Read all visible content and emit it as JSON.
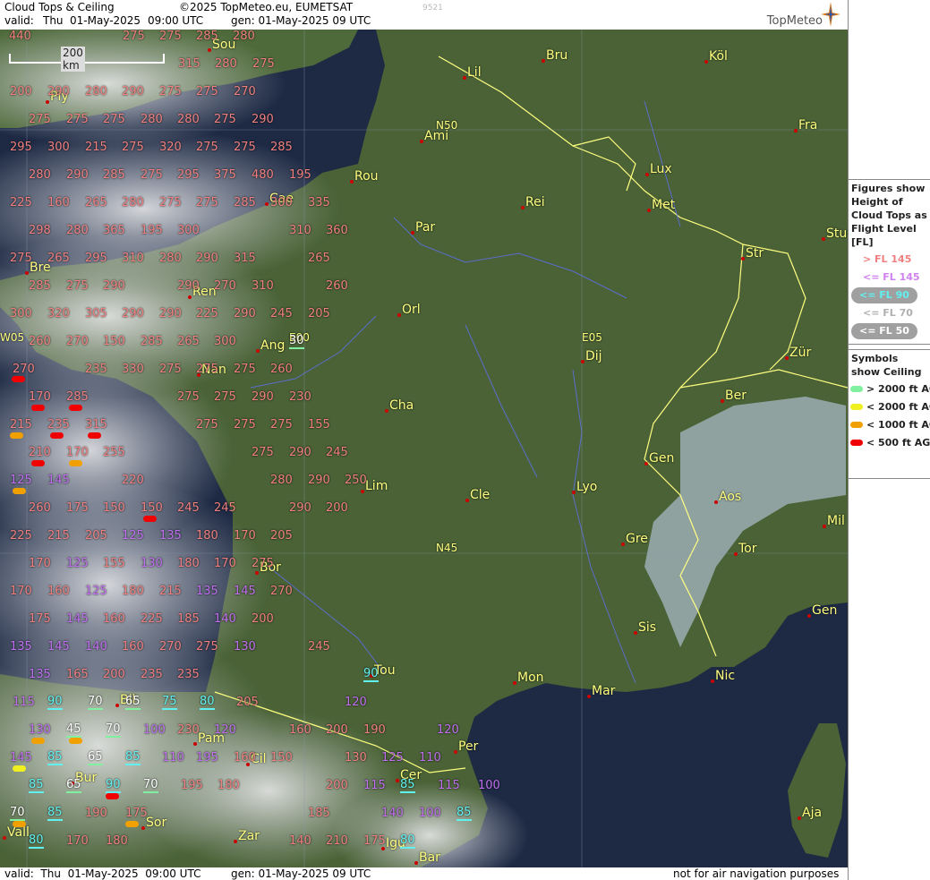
{
  "header": {
    "title": "Cloud Tops & Ceiling",
    "copyright": "©2025 TopMeteo.eu, EUMETSAT",
    "valid_label": "valid:",
    "valid_day": "Thu",
    "valid_date": "01-May-2025",
    "valid_time": "09:00 UTC",
    "gen": "gen: 01-May-2025 09 UTC",
    "code": "9521",
    "brand": "TopMeteo"
  },
  "footer": {
    "valid": "valid:  Thu  01-May-2025  09:00 UTC",
    "gen": "gen: 01-May-2025 09 UTC",
    "disclaimer": "not for air navigation purposes"
  },
  "scale": {
    "label": "200 km"
  },
  "grid_labels": [
    "N50",
    "E00",
    "E05",
    "N45",
    "W05"
  ],
  "cities": [
    {
      "name": "Sou"
    },
    {
      "name": "Bru"
    },
    {
      "name": "Köl"
    },
    {
      "name": "Lil"
    },
    {
      "name": "Ply"
    },
    {
      "name": "Ami"
    },
    {
      "name": "Fra"
    },
    {
      "name": "Lux"
    },
    {
      "name": "Rou"
    },
    {
      "name": "Cae"
    },
    {
      "name": "Rei"
    },
    {
      "name": "Met"
    },
    {
      "name": "Par"
    },
    {
      "name": "Stu"
    },
    {
      "name": "Str"
    },
    {
      "name": "Bre"
    },
    {
      "name": "Ren"
    },
    {
      "name": "Orl"
    },
    {
      "name": "Ang"
    },
    {
      "name": "Nan"
    },
    {
      "name": "Dij"
    },
    {
      "name": "Zür"
    },
    {
      "name": "Ber"
    },
    {
      "name": "Cha"
    },
    {
      "name": "Gen"
    },
    {
      "name": "Lim"
    },
    {
      "name": "Cle"
    },
    {
      "name": "Lyo"
    },
    {
      "name": "Aos"
    },
    {
      "name": "Mil"
    },
    {
      "name": "Gre"
    },
    {
      "name": "Tor"
    },
    {
      "name": "Bor"
    },
    {
      "name": "Sis"
    },
    {
      "name": "Gen"
    },
    {
      "name": "Tou"
    },
    {
      "name": "Mon"
    },
    {
      "name": "Mar"
    },
    {
      "name": "Nic"
    },
    {
      "name": "Bil"
    },
    {
      "name": "Pam"
    },
    {
      "name": "Cil"
    },
    {
      "name": "Per"
    },
    {
      "name": "Cer"
    },
    {
      "name": "Bur"
    },
    {
      "name": "Sor"
    },
    {
      "name": "Vall"
    },
    {
      "name": "Zar"
    },
    {
      "name": "Igu"
    },
    {
      "name": "Bar"
    },
    {
      "name": "Aja"
    }
  ],
  "fl_values": [
    {
      "v": "440",
      "c": "salmon"
    },
    {
      "v": "275",
      "c": "salmon"
    },
    {
      "v": "275",
      "c": "salmon"
    },
    {
      "v": "285",
      "c": "salmon"
    },
    {
      "v": "280",
      "c": "salmon"
    },
    {
      "v": "315",
      "c": "salmon"
    },
    {
      "v": "280",
      "c": "salmon"
    },
    {
      "v": "275",
      "c": "salmon"
    },
    {
      "v": "200",
      "c": "salmon"
    },
    {
      "v": "290",
      "c": "salmon"
    },
    {
      "v": "280",
      "c": "salmon"
    },
    {
      "v": "290",
      "c": "salmon"
    },
    {
      "v": "275",
      "c": "salmon"
    },
    {
      "v": "275",
      "c": "salmon"
    },
    {
      "v": "270",
      "c": "salmon"
    },
    {
      "v": "275",
      "c": "salmon"
    },
    {
      "v": "275",
      "c": "salmon"
    },
    {
      "v": "275",
      "c": "salmon"
    },
    {
      "v": "280",
      "c": "salmon"
    },
    {
      "v": "280",
      "c": "salmon"
    },
    {
      "v": "275",
      "c": "salmon"
    },
    {
      "v": "290",
      "c": "salmon"
    },
    {
      "v": "295",
      "c": "salmon"
    },
    {
      "v": "300",
      "c": "salmon"
    },
    {
      "v": "215",
      "c": "salmon"
    },
    {
      "v": "275",
      "c": "salmon"
    },
    {
      "v": "320",
      "c": "salmon"
    },
    {
      "v": "275",
      "c": "salmon"
    },
    {
      "v": "275",
      "c": "salmon"
    },
    {
      "v": "285",
      "c": "salmon"
    },
    {
      "v": "280",
      "c": "salmon"
    },
    {
      "v": "290",
      "c": "salmon"
    },
    {
      "v": "285",
      "c": "salmon"
    },
    {
      "v": "275",
      "c": "salmon"
    },
    {
      "v": "295",
      "c": "salmon"
    },
    {
      "v": "375",
      "c": "salmon"
    },
    {
      "v": "480",
      "c": "salmon"
    },
    {
      "v": "195",
      "c": "salmon"
    },
    {
      "v": "225",
      "c": "salmon"
    },
    {
      "v": "160",
      "c": "salmon"
    },
    {
      "v": "265",
      "c": "salmon"
    },
    {
      "v": "280",
      "c": "salmon"
    },
    {
      "v": "275",
      "c": "salmon"
    },
    {
      "v": "275",
      "c": "salmon"
    },
    {
      "v": "285",
      "c": "salmon"
    },
    {
      "v": "300",
      "c": "salmon"
    },
    {
      "v": "335",
      "c": "salmon"
    },
    {
      "v": "298",
      "c": "salmon"
    },
    {
      "v": "280",
      "c": "salmon"
    },
    {
      "v": "365",
      "c": "salmon"
    },
    {
      "v": "195",
      "c": "salmon"
    },
    {
      "v": "300",
      "c": "salmon"
    },
    {
      "v": "310",
      "c": "salmon"
    },
    {
      "v": "360",
      "c": "salmon"
    },
    {
      "v": "275",
      "c": "salmon"
    },
    {
      "v": "265",
      "c": "salmon"
    },
    {
      "v": "295",
      "c": "salmon"
    },
    {
      "v": "310",
      "c": "salmon"
    },
    {
      "v": "280",
      "c": "salmon"
    },
    {
      "v": "290",
      "c": "salmon"
    },
    {
      "v": "315",
      "c": "salmon"
    },
    {
      "v": "265",
      "c": "salmon"
    },
    {
      "v": "285",
      "c": "salmon"
    },
    {
      "v": "275",
      "c": "salmon"
    },
    {
      "v": "290",
      "c": "salmon"
    },
    {
      "v": "290",
      "c": "salmon"
    },
    {
      "v": "270",
      "c": "salmon"
    },
    {
      "v": "310",
      "c": "salmon"
    },
    {
      "v": "260",
      "c": "salmon"
    },
    {
      "v": "300",
      "c": "salmon"
    },
    {
      "v": "320",
      "c": "salmon"
    },
    {
      "v": "305",
      "c": "salmon"
    },
    {
      "v": "290",
      "c": "salmon"
    },
    {
      "v": "290",
      "c": "salmon"
    },
    {
      "v": "225",
      "c": "salmon"
    },
    {
      "v": "290",
      "c": "salmon"
    },
    {
      "v": "245",
      "c": "salmon"
    },
    {
      "v": "205",
      "c": "salmon"
    },
    {
      "v": "260",
      "c": "salmon"
    },
    {
      "v": "270",
      "c": "salmon"
    },
    {
      "v": "150",
      "c": "salmon"
    },
    {
      "v": "285",
      "c": "salmon"
    },
    {
      "v": "265",
      "c": "salmon"
    },
    {
      "v": "300",
      "c": "salmon"
    },
    {
      "v": "30",
      "c": "white"
    },
    {
      "v": "270",
      "c": "salmon"
    },
    {
      "v": "235",
      "c": "salmon"
    },
    {
      "v": "330",
      "c": "salmon"
    },
    {
      "v": "275",
      "c": "salmon"
    },
    {
      "v": "275",
      "c": "salmon"
    },
    {
      "v": "275",
      "c": "salmon"
    },
    {
      "v": "260",
      "c": "salmon"
    },
    {
      "v": "170",
      "c": "salmon"
    },
    {
      "v": "285",
      "c": "salmon"
    },
    {
      "v": "275",
      "c": "salmon"
    },
    {
      "v": "275",
      "c": "salmon"
    },
    {
      "v": "290",
      "c": "salmon"
    },
    {
      "v": "230",
      "c": "salmon"
    },
    {
      "v": "215",
      "c": "salmon"
    },
    {
      "v": "235",
      "c": "salmon"
    },
    {
      "v": "315",
      "c": "salmon"
    },
    {
      "v": "275",
      "c": "salmon"
    },
    {
      "v": "275",
      "c": "salmon"
    },
    {
      "v": "275",
      "c": "salmon"
    },
    {
      "v": "155",
      "c": "salmon"
    },
    {
      "v": "210",
      "c": "salmon"
    },
    {
      "v": "170",
      "c": "salmon"
    },
    {
      "v": "255",
      "c": "salmon"
    },
    {
      "v": "275",
      "c": "salmon"
    },
    {
      "v": "290",
      "c": "salmon"
    },
    {
      "v": "245",
      "c": "salmon"
    },
    {
      "v": "125",
      "c": "violet"
    },
    {
      "v": "145",
      "c": "violet"
    },
    {
      "v": "220",
      "c": "salmon"
    },
    {
      "v": "280",
      "c": "salmon"
    },
    {
      "v": "290",
      "c": "salmon"
    },
    {
      "v": "250",
      "c": "salmon"
    },
    {
      "v": "260",
      "c": "salmon"
    },
    {
      "v": "175",
      "c": "salmon"
    },
    {
      "v": "150",
      "c": "salmon"
    },
    {
      "v": "150",
      "c": "salmon"
    },
    {
      "v": "245",
      "c": "salmon"
    },
    {
      "v": "245",
      "c": "salmon"
    },
    {
      "v": "290",
      "c": "salmon"
    },
    {
      "v": "200",
      "c": "salmon"
    },
    {
      "v": "225",
      "c": "salmon"
    },
    {
      "v": "215",
      "c": "salmon"
    },
    {
      "v": "205",
      "c": "salmon"
    },
    {
      "v": "125",
      "c": "violet"
    },
    {
      "v": "135",
      "c": "violet"
    },
    {
      "v": "180",
      "c": "salmon"
    },
    {
      "v": "170",
      "c": "salmon"
    },
    {
      "v": "205",
      "c": "salmon"
    },
    {
      "v": "170",
      "c": "salmon"
    },
    {
      "v": "125",
      "c": "violet"
    },
    {
      "v": "155",
      "c": "salmon"
    },
    {
      "v": "130",
      "c": "violet"
    },
    {
      "v": "180",
      "c": "salmon"
    },
    {
      "v": "170",
      "c": "salmon"
    },
    {
      "v": "275",
      "c": "salmon"
    },
    {
      "v": "170",
      "c": "salmon"
    },
    {
      "v": "160",
      "c": "salmon"
    },
    {
      "v": "125",
      "c": "violet"
    },
    {
      "v": "180",
      "c": "salmon"
    },
    {
      "v": "215",
      "c": "salmon"
    },
    {
      "v": "135",
      "c": "violet"
    },
    {
      "v": "145",
      "c": "violet"
    },
    {
      "v": "270",
      "c": "salmon"
    },
    {
      "v": "175",
      "c": "salmon"
    },
    {
      "v": "145",
      "c": "violet"
    },
    {
      "v": "160",
      "c": "salmon"
    },
    {
      "v": "225",
      "c": "salmon"
    },
    {
      "v": "185",
      "c": "salmon"
    },
    {
      "v": "140",
      "c": "violet"
    },
    {
      "v": "200",
      "c": "salmon"
    },
    {
      "v": "135",
      "c": "violet"
    },
    {
      "v": "145",
      "c": "violet"
    },
    {
      "v": "140",
      "c": "violet"
    },
    {
      "v": "160",
      "c": "salmon"
    },
    {
      "v": "270",
      "c": "salmon"
    },
    {
      "v": "275",
      "c": "salmon"
    },
    {
      "v": "130",
      "c": "violet"
    },
    {
      "v": "245",
      "c": "salmon"
    },
    {
      "v": "135",
      "c": "violet"
    },
    {
      "v": "165",
      "c": "salmon"
    },
    {
      "v": "200",
      "c": "salmon"
    },
    {
      "v": "235",
      "c": "salmon"
    },
    {
      "v": "235",
      "c": "salmon"
    },
    {
      "v": "90",
      "c": "cyan"
    },
    {
      "v": "115",
      "c": "violet"
    },
    {
      "v": "90",
      "c": "cyan"
    },
    {
      "v": "70",
      "c": "white"
    },
    {
      "v": "65",
      "c": "white"
    },
    {
      "v": "75",
      "c": "cyan"
    },
    {
      "v": "80",
      "c": "cyan"
    },
    {
      "v": "205",
      "c": "salmon"
    },
    {
      "v": "120",
      "c": "violet"
    },
    {
      "v": "130",
      "c": "violet"
    },
    {
      "v": "45",
      "c": "white"
    },
    {
      "v": "70",
      "c": "white"
    },
    {
      "v": "100",
      "c": "violet"
    },
    {
      "v": "230",
      "c": "salmon"
    },
    {
      "v": "120",
      "c": "violet"
    },
    {
      "v": "160",
      "c": "salmon"
    },
    {
      "v": "200",
      "c": "salmon"
    },
    {
      "v": "190",
      "c": "salmon"
    },
    {
      "v": "120",
      "c": "violet"
    },
    {
      "v": "145",
      "c": "violet"
    },
    {
      "v": "85",
      "c": "cyan"
    },
    {
      "v": "65",
      "c": "white"
    },
    {
      "v": "85",
      "c": "cyan"
    },
    {
      "v": "110",
      "c": "violet"
    },
    {
      "v": "195",
      "c": "violet"
    },
    {
      "v": "160",
      "c": "salmon"
    },
    {
      "v": "150",
      "c": "salmon"
    },
    {
      "v": "130",
      "c": "salmon"
    },
    {
      "v": "125",
      "c": "violet"
    },
    {
      "v": "110",
      "c": "violet"
    },
    {
      "v": "85",
      "c": "cyan"
    },
    {
      "v": "65",
      "c": "white"
    },
    {
      "v": "90",
      "c": "cyan"
    },
    {
      "v": "70",
      "c": "white"
    },
    {
      "v": "195",
      "c": "salmon"
    },
    {
      "v": "180",
      "c": "salmon"
    },
    {
      "v": "200",
      "c": "salmon"
    },
    {
      "v": "115",
      "c": "violet"
    },
    {
      "v": "85",
      "c": "cyan"
    },
    {
      "v": "115",
      "c": "violet"
    },
    {
      "v": "100",
      "c": "violet"
    },
    {
      "v": "70",
      "c": "white"
    },
    {
      "v": "85",
      "c": "cyan"
    },
    {
      "v": "190",
      "c": "salmon"
    },
    {
      "v": "175",
      "c": "salmon"
    },
    {
      "v": "185",
      "c": "salmon"
    },
    {
      "v": "140",
      "c": "violet"
    },
    {
      "v": "100",
      "c": "violet"
    },
    {
      "v": "85",
      "c": "cyan"
    },
    {
      "v": "80",
      "c": "cyan"
    },
    {
      "v": "170",
      "c": "salmon"
    },
    {
      "v": "180",
      "c": "salmon"
    },
    {
      "v": "140",
      "c": "salmon"
    },
    {
      "v": "210",
      "c": "salmon"
    },
    {
      "v": "175",
      "c": "salmon"
    },
    {
      "v": "80",
      "c": "cyan"
    }
  ],
  "legend": {
    "fl_title": "Figures show Height of Cloud Tops as Flight Level  [FL]",
    "fl_items": [
      {
        "label": "> FL 145",
        "color": "#f08080",
        "pill": false
      },
      {
        "label": "<= FL 145",
        "color": "#d080f0",
        "pill": false
      },
      {
        "label": "<= FL 90",
        "color": "#60f0f0",
        "pill": true
      },
      {
        "label": "<= FL 70",
        "color": "#b0b0b0",
        "pill": false
      },
      {
        "label": "<= FL 50",
        "color": "#ffffff",
        "pill": true
      }
    ],
    "ceiling_title": "Symbols show Ceiling",
    "ceiling_items": [
      {
        "label": "> 2000 ft AGL",
        "color": "#80f0a0"
      },
      {
        "label": "< 2000 ft AGL",
        "color": "#f0f020"
      },
      {
        "label": "< 1000 ft AGL",
        "color": "#f0a000"
      },
      {
        "label": "< 500 ft AGL",
        "color": "#f00000"
      }
    ]
  },
  "colors": {
    "salmon": "#f08080",
    "violet": "#c070f0",
    "cyan": "#60f0f0",
    "white": "#ffffff",
    "city": "#ffff80",
    "border": "#ffff80",
    "river": "#6070f0"
  }
}
